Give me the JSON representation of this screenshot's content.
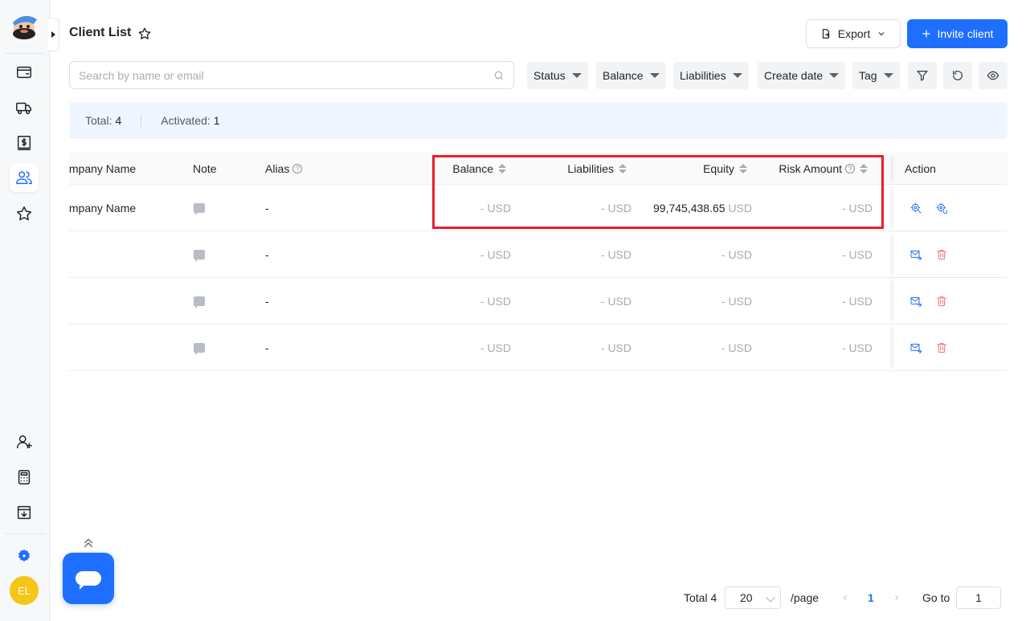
{
  "header": {
    "title": "Client List",
    "export_label": "Export",
    "invite_label": "Invite client"
  },
  "search": {
    "placeholder": "Search by name or email"
  },
  "filters": [
    "Status",
    "Balance",
    "Liabilities",
    "Create date",
    "Tag"
  ],
  "summary": {
    "total_label": "Total:",
    "total_value": "4",
    "activated_label": "Activated:",
    "activated_value": "1"
  },
  "table": {
    "columns": {
      "company": "Company Name",
      "note": "Note",
      "alias": "Alias",
      "balance": "Balance",
      "liabilities": "Liabilities",
      "equity": "Equity",
      "risk": "Risk Amount",
      "action": "Action"
    },
    "currency": "USD",
    "rows": [
      {
        "company": "Company Name",
        "alias": "-",
        "balance": "-",
        "liabilities": "-",
        "equity": "99,745,438.65",
        "risk": "-"
      },
      {
        "company": "",
        "alias": "-",
        "balance": "-",
        "liabilities": "-",
        "equity": "-",
        "risk": "-"
      },
      {
        "company": "",
        "alias": "-",
        "balance": "-",
        "liabilities": "-",
        "equity": "-",
        "risk": "-"
      },
      {
        "company": "",
        "alias": "-",
        "balance": "-",
        "liabilities": "-",
        "equity": "-",
        "risk": "-"
      }
    ]
  },
  "pagination": {
    "total_label": "Total 4",
    "page_size": "20",
    "per_page_label": "/page",
    "current_page": "1",
    "goto_label": "Go to",
    "goto_value": "1"
  },
  "user": {
    "initials": "EL"
  },
  "colors": {
    "primary": "#1e6fff",
    "highlight": "#e8202a",
    "danger": "#f56c6c"
  }
}
